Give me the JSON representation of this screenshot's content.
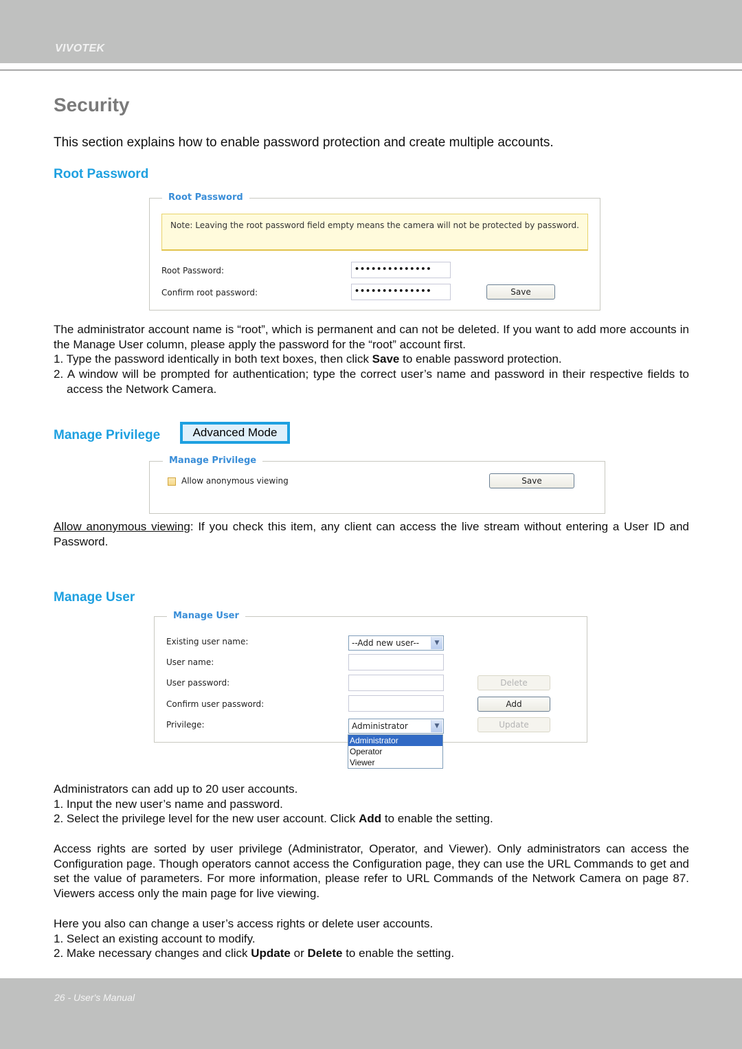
{
  "header": {
    "brand": "VIVOTEK"
  },
  "footer": {
    "page_label": "26 - User's Manual"
  },
  "page": {
    "title": "Security",
    "intro": "This section explains how to enable password protection and create multiple accounts."
  },
  "root_password": {
    "heading": "Root Password",
    "panel": {
      "legend": "Root Password",
      "note": "Note: Leaving the root password field empty means the camera will not be protected by password.",
      "root_password_label": "Root Password:",
      "root_password_value": "••••••••••••••",
      "confirm_label": "Confirm root password:",
      "confirm_value": "••••••••••••••",
      "save_label": "Save"
    },
    "para1": "The administrator account name is “root”, which is permanent and can not be deleted. If you want to add more accounts in the Manage User column, please apply the password for the “root” account first.",
    "step1_pre": "1. Type the password identically in both text boxes, then click ",
    "step1_bold": "Save",
    "step1_post": " to enable password protection.",
    "step2": "2. A window will be prompted for authentication; type the correct user’s name and password in their respective fields to access the Network Camera."
  },
  "manage_privilege": {
    "heading": "Manage Privilege",
    "badge": "Advanced Mode",
    "panel": {
      "legend": "Manage Privilege",
      "checkbox_label": "Allow anonymous viewing",
      "checkbox_checked": false,
      "save_label": "Save"
    },
    "para_term": "Allow anonymous viewing",
    "para_rest": ": If you check this item, any client can access the live stream without entering a User ID and Password."
  },
  "manage_user": {
    "heading": "Manage User",
    "panel": {
      "legend": "Manage User",
      "existing_label": "Existing user name:",
      "existing_value": "--Add new user--",
      "username_label": "User name:",
      "username_value": "",
      "password_label": "User password:",
      "password_value": "",
      "confirm_label": "Confirm user password:",
      "confirm_value": "",
      "privilege_label": "Privilege:",
      "privilege_value": "Administrator",
      "privilege_options": [
        "Administrator",
        "Operator",
        "Viewer"
      ],
      "delete_label": "Delete",
      "add_label": "Add",
      "update_label": "Update"
    },
    "para1": "Administrators can add up to 20 user accounts.",
    "step1": "1. Input the new user’s name and password.",
    "step2_pre": "2. Select the privilege level for the new user account. Click ",
    "step2_bold": "Add",
    "step2_post": " to enable the setting.",
    "para2": "Access rights are sorted by user privilege (Administrator, Operator, and Viewer). Only administrators can access the Configuration page. Though operators cannot access the Configuration page, they can use the URL Commands to get and set the value of parameters. For more information, please refer to URL Commands of the Network Camera on page 87. Viewers access only the main page for live viewing.",
    "para3": "Here you also can change a user’s access rights or delete user accounts.",
    "step3": "1. Select an existing account to modify.",
    "step4_pre": "2. Make necessary changes and click ",
    "step4_bold1": "Update",
    "step4_mid": " or ",
    "step4_bold2": "Delete",
    "step4_post": " to enable the setting."
  }
}
